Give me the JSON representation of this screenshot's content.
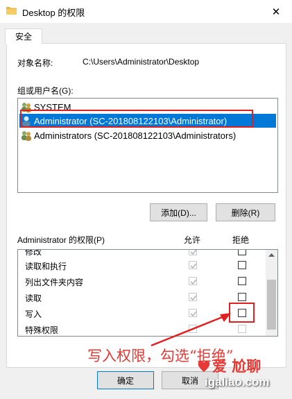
{
  "window": {
    "title": "Desktop 的权限",
    "close_glyph": "✕"
  },
  "tabs": [
    {
      "label": "安全"
    }
  ],
  "object": {
    "label": "对象名称:",
    "value": "C:\\Users\\Administrator\\Desktop"
  },
  "users": {
    "label": "组或用户名(G):",
    "items": [
      {
        "name": "SYSTEM",
        "icon": "group-icon",
        "selected": false
      },
      {
        "name": "Administrator (SC-201808122103\\Administrator)",
        "icon": "user-icon",
        "selected": true
      },
      {
        "name": "Administrators (SC-201808122103\\Administrators)",
        "icon": "group-icon",
        "selected": false
      }
    ]
  },
  "buttons": {
    "add": "添加(D)...",
    "remove": "删除(R)",
    "ok": "确定",
    "cancel": "取消"
  },
  "permissions": {
    "header": "Administrator 的权限(P)",
    "allow_label": "允许",
    "deny_label": "拒绝",
    "rows": [
      {
        "name": "修改",
        "allow": true,
        "allow_disabled": true,
        "deny": false
      },
      {
        "name": "读取和执行",
        "allow": true,
        "allow_disabled": true,
        "deny": false
      },
      {
        "name": "列出文件夹内容",
        "allow": true,
        "allow_disabled": true,
        "deny": false
      },
      {
        "name": "读取",
        "allow": true,
        "allow_disabled": true,
        "deny": false
      },
      {
        "name": "写入",
        "allow": true,
        "allow_disabled": true,
        "deny": false
      },
      {
        "name": "特殊权限",
        "allow": false,
        "allow_disabled": true,
        "deny": false,
        "deny_disabled": true
      }
    ]
  },
  "annotation": {
    "text": "写入权限，勾选“拒绝”"
  },
  "watermark": {
    "brand": "爱 尬聊",
    "url": "igaliao.com"
  },
  "colors": {
    "selection": "#0078d7",
    "annotation_red": "#e02020"
  }
}
